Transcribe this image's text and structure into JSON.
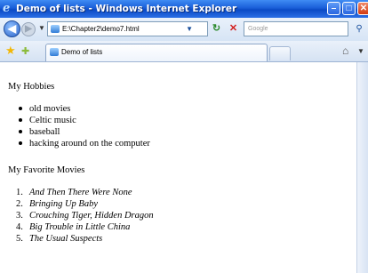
{
  "window": {
    "title": "Demo of lists - Windows Internet Explorer",
    "buttons": {
      "minimize": "–",
      "maximize": "□",
      "close": "✕"
    }
  },
  "toolbar": {
    "address": "E:\\Chapter2\\demo7.html",
    "search_placeholder": "Google"
  },
  "tabs": [
    {
      "label": "Demo of lists"
    }
  ],
  "content": {
    "hobbies_heading": "My Hobbies",
    "hobbies": [
      "old movies",
      "Celtic music",
      "baseball",
      "hacking around on the computer"
    ],
    "movies_heading": "My Favorite Movies",
    "movies": [
      {
        "num": "1.",
        "title": "And Then There Were None"
      },
      {
        "num": "2.",
        "title": "Bringing Up Baby"
      },
      {
        "num": "3.",
        "title": "Crouching Tiger, Hidden Dragon"
      },
      {
        "num": "4.",
        "title": "Big Trouble in Little China"
      },
      {
        "num": "5.",
        "title": "The Usual Suspects"
      }
    ]
  },
  "icons": {
    "ie": "ie-logo-icon",
    "back": "back-arrow-icon",
    "forward": "forward-arrow-icon",
    "refresh": "refresh-icon",
    "stop": "stop-icon",
    "search": "search-icon",
    "favorites": "favorites-star-icon",
    "add_favorites": "add-favorites-icon",
    "home": "home-icon"
  },
  "colors": {
    "titlebar": "#1a5fd8",
    "chrome": "#d6e4f5"
  }
}
